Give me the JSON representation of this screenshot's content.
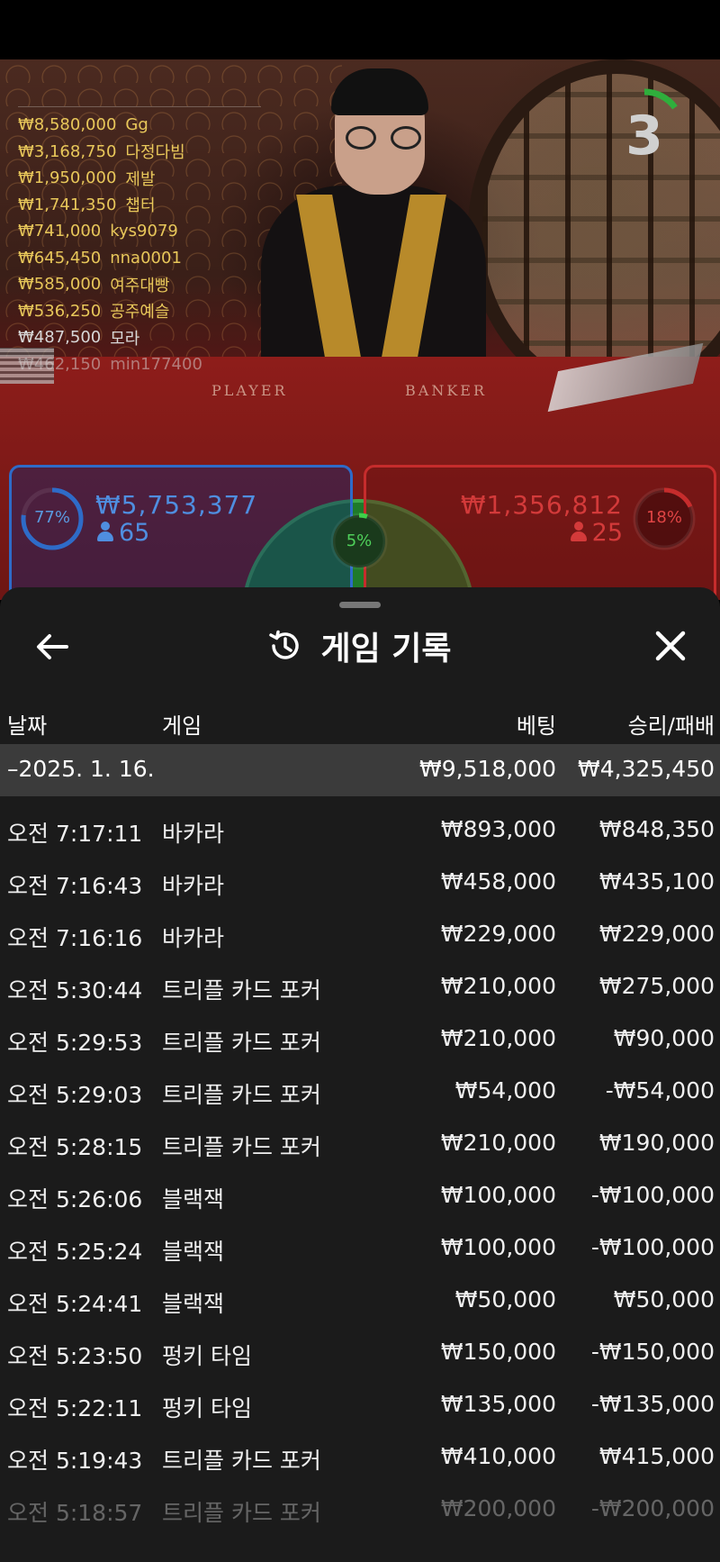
{
  "leaderboard": [
    {
      "amount": "₩8,580,000",
      "name": "Gg",
      "style": "gold"
    },
    {
      "amount": "₩3,168,750",
      "name": "다정다빔",
      "style": "gold"
    },
    {
      "amount": "₩1,950,000",
      "name": "제발",
      "style": "gold"
    },
    {
      "amount": "₩1,741,350",
      "name": "챕터",
      "style": "gold"
    },
    {
      "amount": "₩741,000",
      "name": "kys9079",
      "style": "gold"
    },
    {
      "amount": "₩645,450",
      "name": "nna0001",
      "style": "gold"
    },
    {
      "amount": "₩585,000",
      "name": "여주대빵",
      "style": "gold"
    },
    {
      "amount": "₩536,250",
      "name": "공주예슬",
      "style": "gold"
    },
    {
      "amount": "₩487,500",
      "name": "모라",
      "style": "white"
    },
    {
      "amount": "₩462,150",
      "name": "min177400",
      "style": "faded"
    }
  ],
  "table": {
    "player_label": "PLAYER",
    "banker_label": "BANKER"
  },
  "countdown": {
    "value": "3",
    "progress": 0.15,
    "color": "#2fae3c"
  },
  "player_bet": {
    "percent": "77%",
    "percent_value": 0.77,
    "amount": "₩5,753,377",
    "count": "65",
    "color": "#2e6bc8"
  },
  "banker_bet": {
    "percent": "18%",
    "percent_value": 0.18,
    "amount": "₩1,356,812",
    "count": "25",
    "color": "#c62c2c"
  },
  "tie_bet": {
    "percent": "5%",
    "percent_value": 0.05,
    "color": "#3fd04a"
  },
  "history": {
    "title": "게임 기록",
    "columns": {
      "date": "날짜",
      "game": "게임",
      "bet": "베팅",
      "result": "승리/패배"
    },
    "date_group": {
      "label": "–2025. 1. 16.",
      "total_bet": "₩9,518,000",
      "total_result": "₩4,325,450"
    },
    "rows": [
      {
        "time": "오전 7:17:11",
        "game": "바카라",
        "bet": "₩893,000",
        "result": "₩848,350"
      },
      {
        "time": "오전 7:16:43",
        "game": "바카라",
        "bet": "₩458,000",
        "result": "₩435,100"
      },
      {
        "time": "오전 7:16:16",
        "game": "바카라",
        "bet": "₩229,000",
        "result": "₩229,000"
      },
      {
        "time": "오전 5:30:44",
        "game": "트리플 카드 포커",
        "bet": "₩210,000",
        "result": "₩275,000"
      },
      {
        "time": "오전 5:29:53",
        "game": "트리플 카드 포커",
        "bet": "₩210,000",
        "result": "₩90,000"
      },
      {
        "time": "오전 5:29:03",
        "game": "트리플 카드 포커",
        "bet": "₩54,000",
        "result": "-₩54,000"
      },
      {
        "time": "오전 5:28:15",
        "game": "트리플 카드 포커",
        "bet": "₩210,000",
        "result": "₩190,000"
      },
      {
        "time": "오전 5:26:06",
        "game": "블랙잭",
        "bet": "₩100,000",
        "result": "-₩100,000"
      },
      {
        "time": "오전 5:25:24",
        "game": "블랙잭",
        "bet": "₩100,000",
        "result": "-₩100,000"
      },
      {
        "time": "오전 5:24:41",
        "game": "블랙잭",
        "bet": "₩50,000",
        "result": "₩50,000"
      },
      {
        "time": "오전 5:23:50",
        "game": "펑키 타임",
        "bet": "₩150,000",
        "result": "-₩150,000"
      },
      {
        "time": "오전 5:22:11",
        "game": "펑키 타임",
        "bet": "₩135,000",
        "result": "-₩135,000"
      },
      {
        "time": "오전 5:19:43",
        "game": "트리플 카드 포커",
        "bet": "₩410,000",
        "result": "₩415,000"
      },
      {
        "time": "오전 5:18:57",
        "game": "트리플 카드 포커",
        "bet": "₩200,000",
        "result": "-₩200,000"
      }
    ]
  }
}
